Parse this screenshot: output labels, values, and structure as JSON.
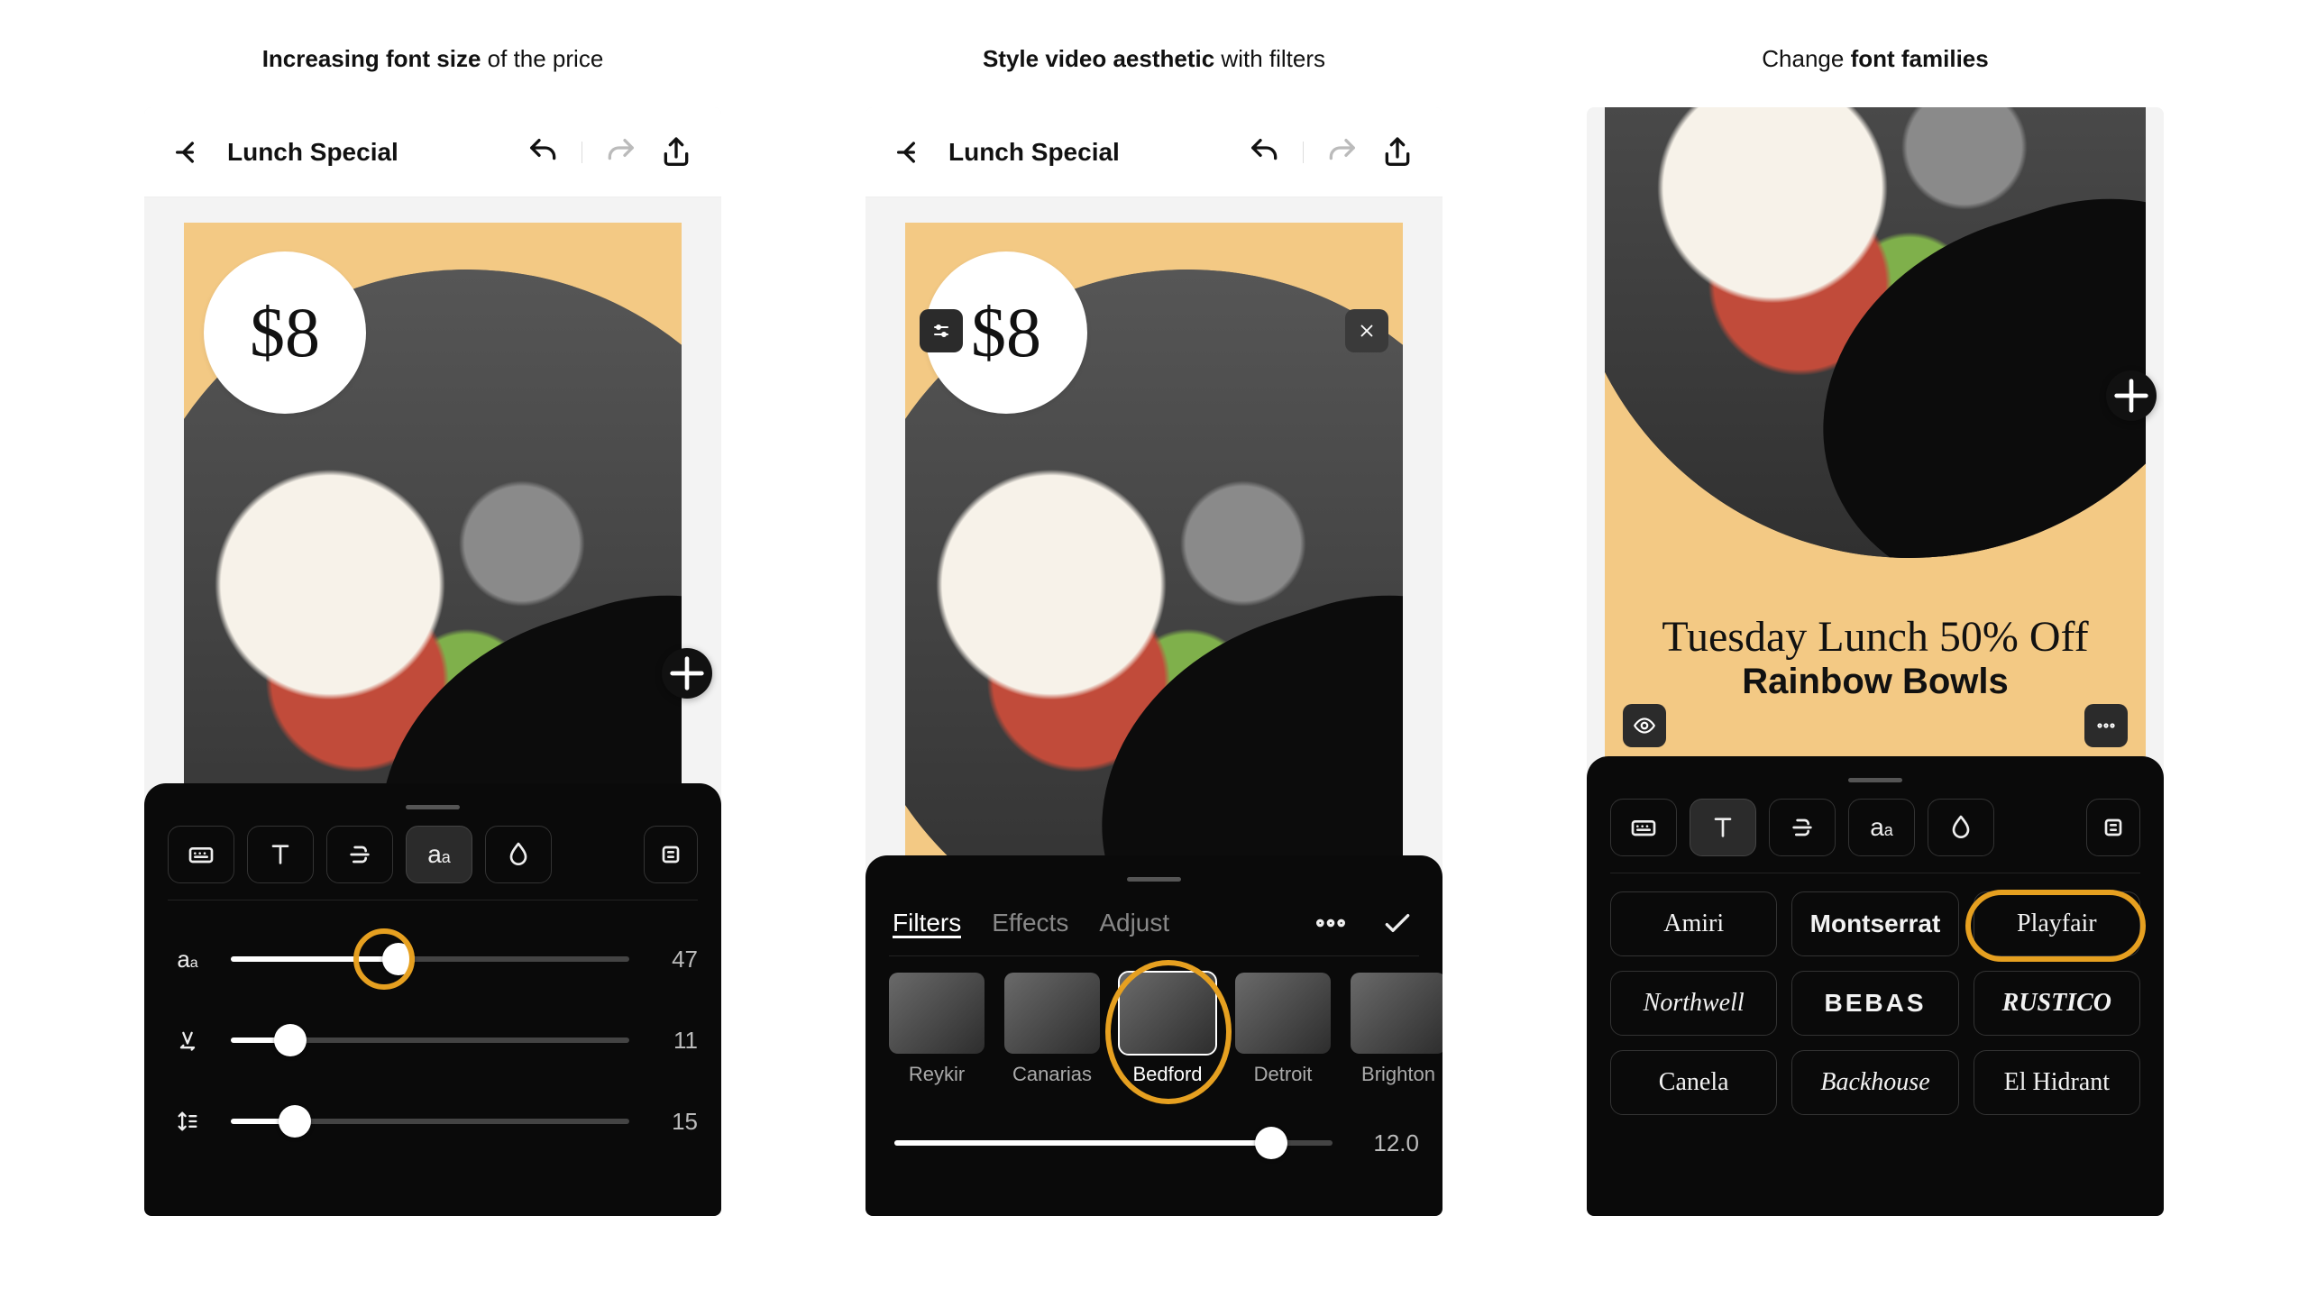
{
  "captions": {
    "c1_bold": "Increasing font size",
    "c1_rest": " of the price",
    "c2_bold": "Style video aesthetic",
    "c2_rest": " with filters",
    "c3_pre": "Change ",
    "c3_bold": "font families"
  },
  "panel1": {
    "title": "Lunch Special",
    "price": "$8",
    "sliders": {
      "size": {
        "value": "47",
        "pct": 42
      },
      "spacing": {
        "value": "11",
        "pct": 15
      },
      "leading": {
        "value": "15",
        "pct": 16
      }
    }
  },
  "panel2": {
    "title": "Lunch Special",
    "price": "$8",
    "tabs": {
      "filters": "Filters",
      "effects": "Effects",
      "adjust": "Adjust"
    },
    "filters": [
      "Reykir",
      "Canarias",
      "Bedford",
      "Detroit",
      "Brighton"
    ],
    "selected_filter": "Bedford",
    "slider": {
      "value": "12.0",
      "pct": 86
    }
  },
  "panel3": {
    "promo1": "Tuesday Lunch 50% Off",
    "promo2": "Rainbow Bowls",
    "fonts": [
      "Amiri",
      "Montserrat",
      "Playfair",
      "Northwell",
      "BEBAS",
      "RUSTICO",
      "Canela",
      "Backhouse",
      "El Hidrant"
    ],
    "highlight": "Playfair"
  }
}
